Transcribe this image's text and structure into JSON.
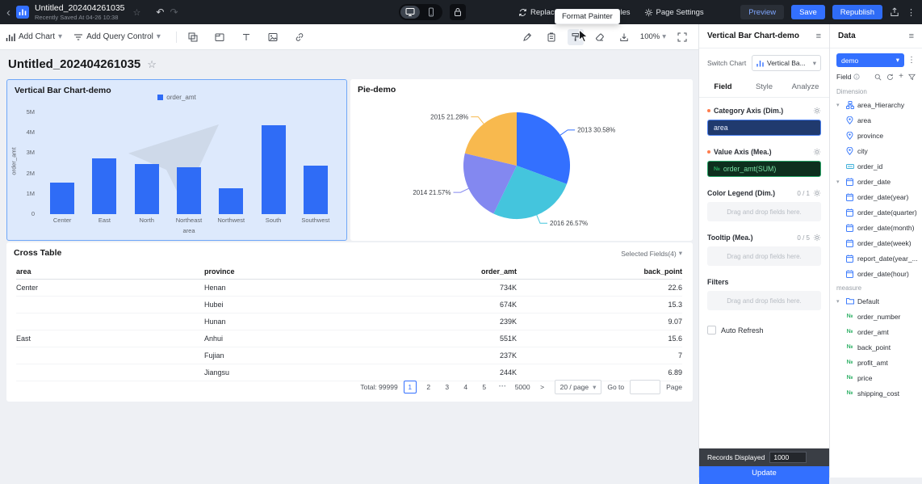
{
  "icons": {
    "back": "‹",
    "star": "☆",
    "undo": "↶",
    "redo": "↷",
    "more_v": "⋮",
    "hamburger": "≡",
    "caret": "▾"
  },
  "topbar": {
    "title": "Untitled_202404261035",
    "subtitle": "Recently Saved At 04-26 10:38",
    "menu": [
      {
        "label": "Replace Data"
      },
      {
        "label": "al Variables"
      },
      {
        "label": "Page Settings"
      }
    ],
    "preview": "Preview",
    "save": "Save",
    "republish": "Republish"
  },
  "tooltip": {
    "label": "Format Painter"
  },
  "toolbar": {
    "add_chart": "Add Chart",
    "add_query": "Add Query Control",
    "zoom": "100%"
  },
  "page": {
    "title": "Untitled_202404261035"
  },
  "chart_data": [
    {
      "type": "bar",
      "title": "Vertical Bar Chart-demo",
      "legend": "order_amt",
      "color": "#2f6cf6",
      "categories": [
        "Center",
        "East",
        "North",
        "Northeast",
        "Northwest",
        "South",
        "Southwest"
      ],
      "values": [
        1550000,
        2750000,
        2450000,
        2300000,
        1250000,
        4350000,
        2400000
      ],
      "xlabel": "area",
      "ylabel": "order_amt",
      "ylim": [
        0,
        5000000
      ],
      "yticks": [
        "0",
        "1M",
        "2M",
        "3M",
        "4M",
        "5M"
      ]
    },
    {
      "type": "pie",
      "title": "Pie-demo",
      "slices": [
        {
          "label": "2013",
          "pct": 30.58,
          "color": "#3370ff"
        },
        {
          "label": "2016",
          "pct": 26.57,
          "color": "#44c5dd"
        },
        {
          "label": "2014",
          "pct": 21.57,
          "color": "#8388f0"
        },
        {
          "label": "2015",
          "pct": 21.28,
          "color": "#f8b94e"
        }
      ]
    },
    {
      "type": "table",
      "title": "Cross Table",
      "selected_fields": "Selected Fields(4)",
      "columns": [
        "area",
        "province",
        "order_amt",
        "back_point"
      ],
      "rows": [
        [
          "Center",
          "Henan",
          "734K",
          "22.6"
        ],
        [
          "",
          "Hubei",
          "674K",
          "15.3"
        ],
        [
          "",
          "Hunan",
          "239K",
          "9.07"
        ],
        [
          "East",
          "Anhui",
          "551K",
          "15.6"
        ],
        [
          "",
          "Fujian",
          "237K",
          "7"
        ],
        [
          "",
          "Jiangsu",
          "244K",
          "6.89"
        ]
      ],
      "pagination": {
        "total": "Total: 99999",
        "pages": [
          "1",
          "2",
          "3",
          "4",
          "5"
        ],
        "current": "1",
        "ellipsis": "•••",
        "last": "5000",
        "next": ">",
        "page_size": "20 / page",
        "goto": "Go to",
        "page_word": "Page"
      }
    }
  ],
  "config": {
    "title": "Vertical Bar Chart-demo",
    "switch_chart_label": "Switch Chart",
    "switch_chart_value": "Vertical Ba...",
    "tabs": [
      "Field",
      "Style",
      "Analyze"
    ],
    "active_tab": "Field",
    "sections": [
      {
        "label": "Category Axis (Dim.)",
        "required": true,
        "gear": true,
        "chips": [
          {
            "text": "area",
            "kind": "dim"
          }
        ]
      },
      {
        "label": "Value Axis (Mea.)",
        "required": true,
        "gear": true,
        "chips": [
          {
            "text": "order_amt(SUM)",
            "kind": "mea"
          }
        ]
      },
      {
        "label": "Color Legend (Dim.)",
        "count": "0 / 1",
        "gear": true,
        "dropzone": "Drag and drop fields here."
      },
      {
        "label": "Tooltip (Mea.)",
        "count": "0 / 5",
        "gear": true,
        "dropzone": "Drag and drop fields here."
      },
      {
        "label": "Filters",
        "dropzone": "Drag and drop fields here."
      }
    ],
    "auto_refresh": "Auto Refresh",
    "records_displayed": "Records Displayed",
    "records_value": "1000",
    "update": "Update"
  },
  "datapanel": {
    "title": "Data",
    "dataset": "demo",
    "field_label": "Field",
    "dimension_label": "Dimension",
    "measure_label": "measure",
    "dim_tree": [
      {
        "label": "area_Hierarchy",
        "icon": "hierarchy",
        "expand": true,
        "level": 0
      },
      {
        "label": "area",
        "icon": "location-pin",
        "level": 1
      },
      {
        "label": "province",
        "icon": "location-pin",
        "level": 1
      },
      {
        "label": "city",
        "icon": "location-pin",
        "level": 1
      },
      {
        "label": "order_id",
        "icon": "id",
        "level": 0
      },
      {
        "label": "order_date",
        "icon": "calendar",
        "expand": true,
        "level": 0
      },
      {
        "label": "order_date(year)",
        "icon": "calendar",
        "level": 1
      },
      {
        "label": "order_date(quarter)",
        "icon": "calendar",
        "level": 1
      },
      {
        "label": "order_date(month)",
        "icon": "calendar",
        "level": 1
      },
      {
        "label": "order_date(week)",
        "icon": "calendar",
        "level": 1
      },
      {
        "label": "report_date(year_...",
        "icon": "calendar",
        "level": 1
      },
      {
        "label": "order_date(hour)",
        "icon": "calendar",
        "level": 1
      }
    ],
    "measure_tree": [
      {
        "label": "Default",
        "icon": "folder",
        "expand": true,
        "level": 0
      },
      {
        "label": "order_number",
        "icon": "measure-number",
        "level": 1
      },
      {
        "label": "order_amt",
        "icon": "measure-number",
        "level": 1
      },
      {
        "label": "back_point",
        "icon": "measure-number",
        "level": 1
      },
      {
        "label": "profit_amt",
        "icon": "measure-number",
        "level": 1
      },
      {
        "label": "price",
        "icon": "measure-number",
        "level": 1
      },
      {
        "label": "shipping_cost",
        "icon": "measure-number",
        "level": 1
      }
    ]
  }
}
